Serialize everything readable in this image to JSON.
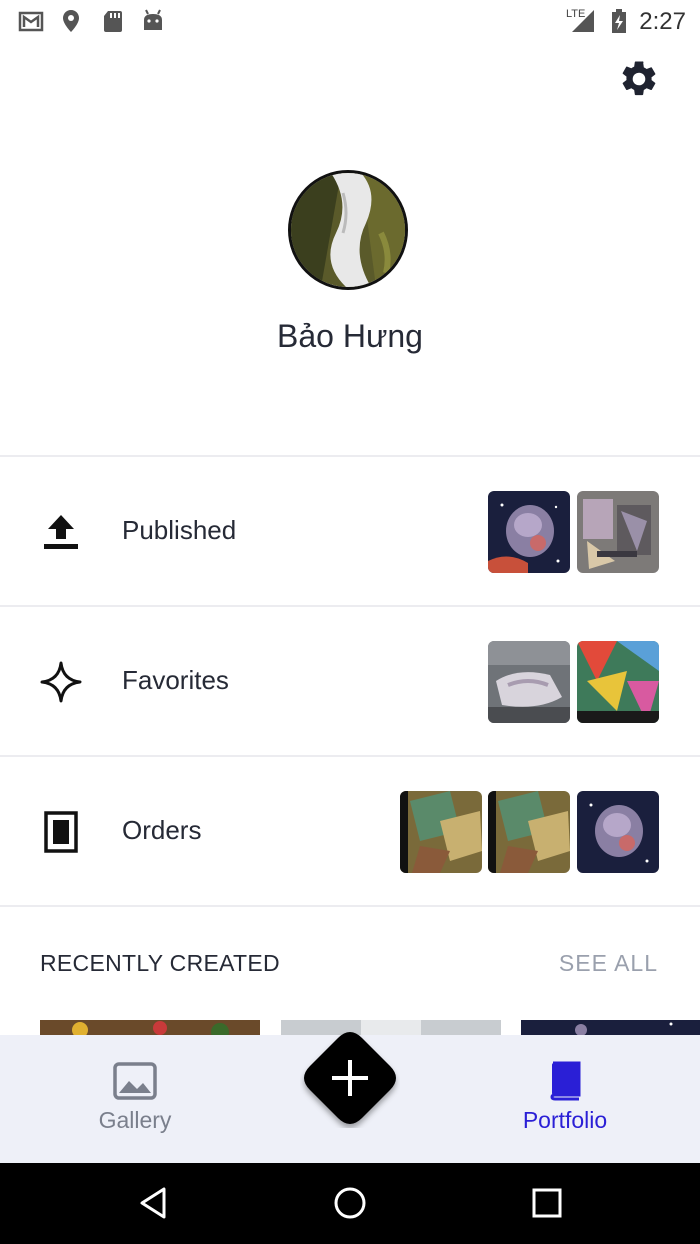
{
  "status_bar": {
    "time": "2:27",
    "network": "LTE",
    "icons": [
      "gmail-icon",
      "location-icon",
      "sd-card-icon",
      "android-icon",
      "signal-icon",
      "battery-charging-icon"
    ]
  },
  "header": {
    "settings_icon": "gear-icon"
  },
  "profile": {
    "name": "Bảo Hưng"
  },
  "rows": [
    {
      "label": "Published",
      "icon": "upload-icon"
    },
    {
      "label": "Favorites",
      "icon": "sparkle-icon"
    },
    {
      "label": "Orders",
      "icon": "frame-icon"
    }
  ],
  "recent": {
    "title": "RECENTLY CREATED",
    "see_all": "SEE ALL"
  },
  "bottom_nav": {
    "gallery_label": "Gallery",
    "portfolio_label": "Portfolio",
    "active": "Portfolio",
    "active_color": "#2a1fd6",
    "inactive_color": "#7a7f8c"
  }
}
